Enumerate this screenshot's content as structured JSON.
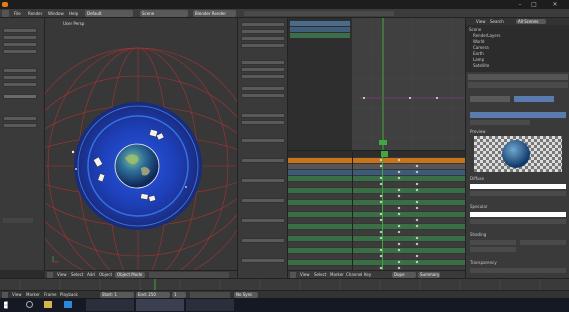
{
  "window": {
    "title": "",
    "icon": "blender-logo-icon"
  },
  "menubar": {
    "items": [
      "File",
      "Render",
      "Window",
      "Help"
    ],
    "layout": "Default",
    "scene": "Scene",
    "engine": "Blender Render"
  },
  "toolshelf": {
    "header": "",
    "items": [
      {
        "label": ""
      },
      {
        "label": ""
      },
      {
        "label": ""
      },
      {
        "label": ""
      },
      {
        "label": ""
      },
      {
        "label": ""
      },
      {
        "label": ""
      },
      {
        "label": ""
      },
      {
        "label": ""
      },
      {
        "label": ""
      }
    ]
  },
  "viewport": {
    "label": "User Persp",
    "object_label": "",
    "background": "#383838",
    "accent": "#1f3fb0"
  },
  "viewport_header": {
    "items": [
      "View",
      "Select",
      "Add",
      "Object",
      "Object Mode"
    ]
  },
  "properties": {
    "rows": [
      {
        "label": ""
      },
      {
        "label": ""
      },
      {
        "label": ""
      },
      {
        "label": ""
      },
      {
        "label": ""
      },
      {
        "label": ""
      },
      {
        "label": ""
      },
      {
        "label": ""
      },
      {
        "label": ""
      },
      {
        "label": ""
      },
      {
        "label": ""
      },
      {
        "label": ""
      }
    ]
  },
  "graph": {
    "frame_marker": "",
    "accent_line": "#3fa83f"
  },
  "dopesheet": {
    "header": "",
    "rows": [
      {
        "label": ""
      },
      {
        "label": ""
      },
      {
        "label": ""
      },
      {
        "label": ""
      },
      {
        "label": ""
      },
      {
        "label": ""
      },
      {
        "label": ""
      },
      {
        "label": ""
      },
      {
        "label": ""
      },
      {
        "label": ""
      },
      {
        "label": ""
      },
      {
        "label": ""
      },
      {
        "label": ""
      },
      {
        "label": ""
      },
      {
        "label": ""
      },
      {
        "label": ""
      },
      {
        "label": ""
      },
      {
        "label": ""
      },
      {
        "label": ""
      },
      {
        "label": ""
      }
    ]
  },
  "dopesheet_header": {
    "items": [
      "View",
      "Select",
      "Marker",
      "Channel",
      "Key",
      "Dope Sheet",
      "Summary"
    ]
  },
  "outliner": {
    "items": [
      "",
      "",
      "",
      "",
      "",
      ""
    ]
  },
  "right_panel": {
    "tabs": [
      "View",
      "Search",
      "All Scenes"
    ],
    "tree": [
      "Scene",
      "RenderLayers",
      "World",
      "Camera",
      "Earth",
      "Lamp",
      "Satellite"
    ],
    "sections": [
      "Preview",
      "Diffuse",
      "Specular",
      "Shading",
      "Transparency"
    ]
  },
  "timeline": {
    "start_label": "Start:",
    "start": "1",
    "end_label": "End:",
    "end": "250",
    "frame": "1",
    "sync": "No Sync"
  },
  "timeline_header": {
    "items": [
      "View",
      "Marker",
      "Frame",
      "Playback"
    ]
  },
  "taskbar": {
    "apps": [
      "",
      "",
      "",
      ""
    ],
    "time": "",
    "date": ""
  }
}
